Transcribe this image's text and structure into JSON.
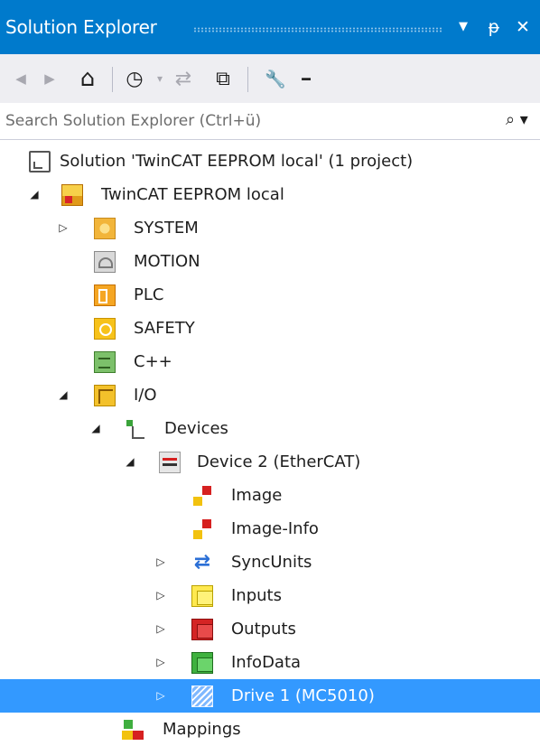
{
  "panel": {
    "title": "Solution Explorer",
    "buttons": {
      "dropdown": "▼",
      "pin": "ᵽ",
      "close": "✕"
    }
  },
  "toolbar": {
    "items": [
      {
        "name": "back-button",
        "glyph": "◀"
      },
      {
        "name": "forward-button",
        "glyph": "▶"
      },
      {
        "name": "home-button",
        "glyph": "⌂"
      },
      {
        "name": "pending-changes-filter-button",
        "glyph": "◷"
      },
      {
        "name": "sync-with-active-document-button",
        "glyph": "⇄"
      },
      {
        "name": "collapse-all-button",
        "glyph": "⧉"
      },
      {
        "name": "properties-button",
        "glyph": "🔧"
      },
      {
        "name": "minus-button",
        "glyph": "━"
      }
    ]
  },
  "search": {
    "placeholder": "Search Solution Explorer (Ctrl+ü)",
    "icon": "⌕ ▾"
  },
  "tree": {
    "selected": "Drive 1 (MC5010)",
    "items": [
      {
        "label": "Solution 'TwinCAT EEPROM local' (1 project)",
        "icon": "solution-icon",
        "expander": ""
      },
      {
        "label": "TwinCAT EEPROM local",
        "icon": "project-icon",
        "expander": "◢"
      },
      {
        "label": "SYSTEM",
        "icon": "system-icon",
        "expander": "▷"
      },
      {
        "label": "MOTION",
        "icon": "motion-icon",
        "expander": ""
      },
      {
        "label": "PLC",
        "icon": "plc-icon",
        "expander": ""
      },
      {
        "label": "SAFETY",
        "icon": "safety-icon",
        "expander": ""
      },
      {
        "label": "C++",
        "icon": "cpp-icon",
        "expander": ""
      },
      {
        "label": "I/O",
        "icon": "io-icon",
        "expander": "◢"
      },
      {
        "label": "Devices",
        "icon": "devices-icon",
        "expander": "◢"
      },
      {
        "label": "Device 2 (EtherCAT)",
        "icon": "ethercat-icon",
        "expander": "◢"
      },
      {
        "label": "Image",
        "icon": "image-icon",
        "expander": ""
      },
      {
        "label": "Image-Info",
        "icon": "image-info-icon",
        "expander": ""
      },
      {
        "label": "SyncUnits",
        "icon": "sync-units-icon",
        "expander": "▷"
      },
      {
        "label": "Inputs",
        "icon": "inputs-icon",
        "expander": "▷"
      },
      {
        "label": "Outputs",
        "icon": "outputs-icon",
        "expander": "▷"
      },
      {
        "label": "InfoData",
        "icon": "infodata-icon",
        "expander": "▷"
      },
      {
        "label": "Drive 1 (MC5010)",
        "icon": "drive-icon",
        "expander": "▷"
      },
      {
        "label": "Mappings",
        "icon": "mappings-icon",
        "expander": ""
      }
    ]
  },
  "colors": {
    "titlebar": "#007acc",
    "toolbar": "#eeeef2",
    "selection": "#3399ff"
  }
}
